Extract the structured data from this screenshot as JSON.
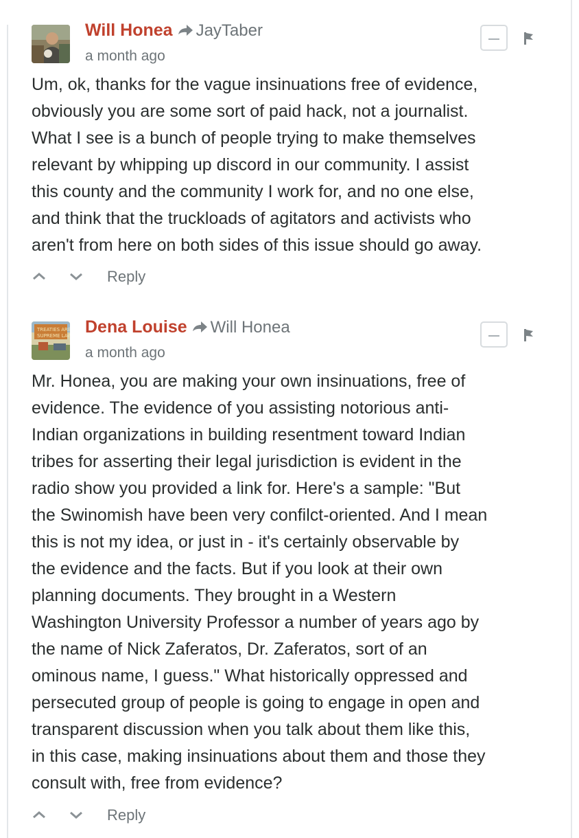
{
  "comments": [
    {
      "author": "Will Honea",
      "in_reply_to": "JayTaber",
      "timestamp": "a month ago",
      "body_lines": [
        "Um, ok, thanks for the vague insinuations free of evidence,",
        "obviously you are some sort of paid hack, not a journalist.",
        "What I see is a bunch of people trying to make themselves",
        "relevant by whipping up discord in our community. I assist",
        "this county and the community I work for, and no one else,",
        "and think that the truckloads of agitators and activists who",
        "aren't from here on both sides of this issue should go away."
      ],
      "reply_label": "Reply",
      "upvote_icon": "chevron-up-icon",
      "downvote_icon": "chevron-down-icon",
      "collapse_icon": "minus-icon",
      "flag_icon": "flag-icon",
      "avatar": "user-avatar"
    },
    {
      "author": "Dena Louise",
      "in_reply_to": "Will Honea",
      "timestamp": "a month ago",
      "body_lines": [
        "Mr. Honea, you are making your own insinuations, free of",
        "evidence. The evidence of you assisting notorious anti-",
        "Indian organizations in building resentment toward Indian",
        "tribes for asserting their legal jurisdiction is evident in the",
        "radio show you provided a link for. Here's a sample: \"But",
        "the Swinomish have been very confilct-oriented. And I mean",
        "this is not my idea, or just in - it's certainly observable by",
        "the evidence and the facts. But if you look at their own",
        "planning documents. They brought in a Western",
        "Washington University Professor a number of years ago by",
        "the name of Nick Zaferatos, Dr. Zaferatos, sort of an",
        "ominous name, I guess.\" What historically oppressed and",
        "persecuted group of people is going to engage in open and",
        "transparent discussion when you talk about them like this,",
        "in this case, making insinuations about them and those they",
        "consult with, free from evidence?"
      ],
      "reply_label": "Reply",
      "upvote_icon": "chevron-up-icon",
      "downvote_icon": "chevron-down-icon",
      "collapse_icon": "minus-icon",
      "flag_icon": "flag-icon",
      "avatar": "user-avatar"
    }
  ],
  "colors": {
    "author": "#c0412d",
    "meta": "#6d7478",
    "text": "#2a2e2e",
    "rule": "#e3e6e9"
  }
}
